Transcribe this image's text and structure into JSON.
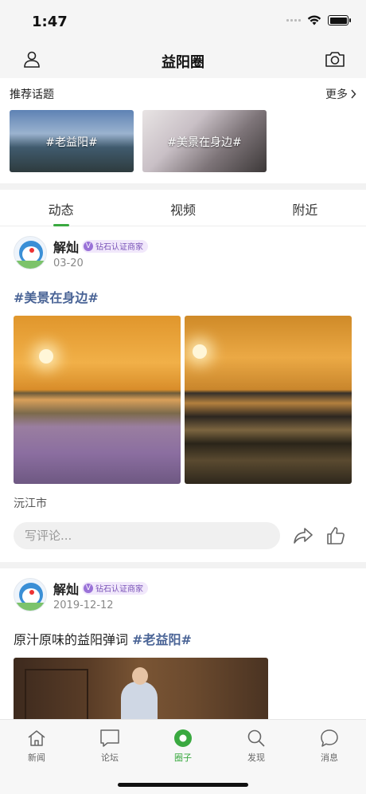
{
  "status": {
    "time": "1:47"
  },
  "nav": {
    "title": "益阳圈",
    "left_icon": "user-icon",
    "right_icon": "camera-icon"
  },
  "topics": {
    "title": "推荐话题",
    "more": "更多",
    "cards": [
      {
        "label": "#老益阳#"
      },
      {
        "label": "#美景在身边#"
      }
    ]
  },
  "tabs": [
    {
      "label": "动态",
      "active": true
    },
    {
      "label": "视频",
      "active": false
    },
    {
      "label": "附近",
      "active": false
    }
  ],
  "posts": [
    {
      "author": "解灿",
      "badge": "钻石认证商家",
      "badge_mark": "V",
      "date": "03-20",
      "tag": "#美景在身边#",
      "location": "沅江市",
      "comment_placeholder": "写评论..."
    },
    {
      "author": "解灿",
      "badge": "钻石认证商家",
      "badge_mark": "V",
      "date": "2019-12-12",
      "text": "原汁原味的益阳弹词 ",
      "tag": "#老益阳#"
    }
  ],
  "tabbar": [
    {
      "label": "新闻",
      "icon": "home-icon",
      "active": false
    },
    {
      "label": "论坛",
      "icon": "forum-icon",
      "active": false
    },
    {
      "label": "圈子",
      "icon": "circle-icon",
      "active": true
    },
    {
      "label": "发现",
      "icon": "search-icon",
      "active": false
    },
    {
      "label": "消息",
      "icon": "message-icon",
      "active": false
    }
  ],
  "colors": {
    "accent": "#3aa940",
    "tag": "#4a6496",
    "badge": "#9a72d8"
  }
}
